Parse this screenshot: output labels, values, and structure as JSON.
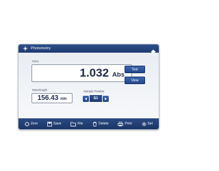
{
  "window": {
    "title": "Photometry"
  },
  "concentration": {
    "label": "Conc",
    "value": "1.032",
    "unit": "Abs"
  },
  "actions": {
    "text_label": "Text",
    "view_label": "View"
  },
  "wavelength": {
    "label": "Wavelength",
    "value": "156.43",
    "unit": "nm"
  },
  "sample_position": {
    "label": "Sample Position",
    "value": "S1"
  },
  "toolbar": {
    "items": [
      {
        "label": "Zero",
        "icon": "zero-icon"
      },
      {
        "label": "Save",
        "icon": "save-icon"
      },
      {
        "label": "File",
        "icon": "folder-icon"
      },
      {
        "label": "Delete",
        "icon": "trash-icon"
      },
      {
        "label": "Print",
        "icon": "print-icon"
      },
      {
        "label": "Set",
        "icon": "gear-icon"
      }
    ]
  },
  "colors": {
    "accent": "#23478b",
    "titlebar": "#1d3a70",
    "panel": "#f2f4f7"
  }
}
